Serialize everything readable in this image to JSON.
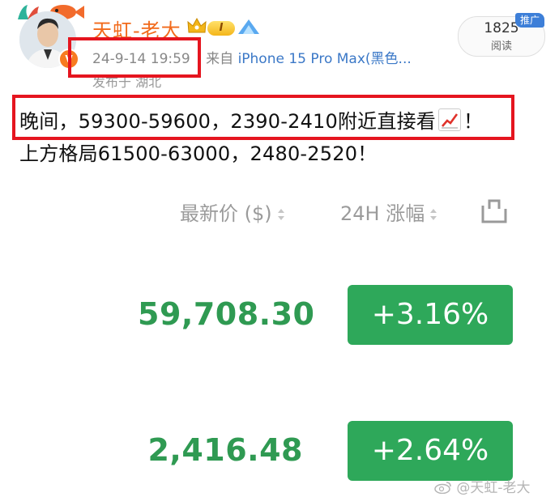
{
  "post": {
    "author": "天虹-老大",
    "level": "I",
    "timestamp": "24-9-14 19:59",
    "source_prefix": "来自",
    "device": "iPhone 15 Pro Max(黑色...",
    "location": "发布于 湖北",
    "line1_before_icon": "晚间，59300-59600，2390-2410附近直接看",
    "line1_after_icon": "！",
    "line2": "上方格局61500-63000，2480-2520！"
  },
  "reads": {
    "count": "1825",
    "label": "阅读",
    "promo": "推广"
  },
  "market": {
    "col_price": "最新价 ($)",
    "col_change": "24H 涨幅",
    "rows": [
      {
        "price": "59,708.30",
        "change": "+3.16%"
      },
      {
        "price": "2,416.48",
        "change": "+2.64%"
      }
    ]
  },
  "watermark": "@天虹-老大",
  "colors": {
    "username": "#f26a1b",
    "highlight_border": "#e5151f",
    "price_green": "#2f9a52",
    "change_green": "#2ea85a",
    "device_link": "#3b78c7"
  },
  "icons": [
    "avatar",
    "crown-icon",
    "vip-icon",
    "chart-increasing-icon",
    "sort-icon",
    "share-icon",
    "weibo-icon"
  ]
}
